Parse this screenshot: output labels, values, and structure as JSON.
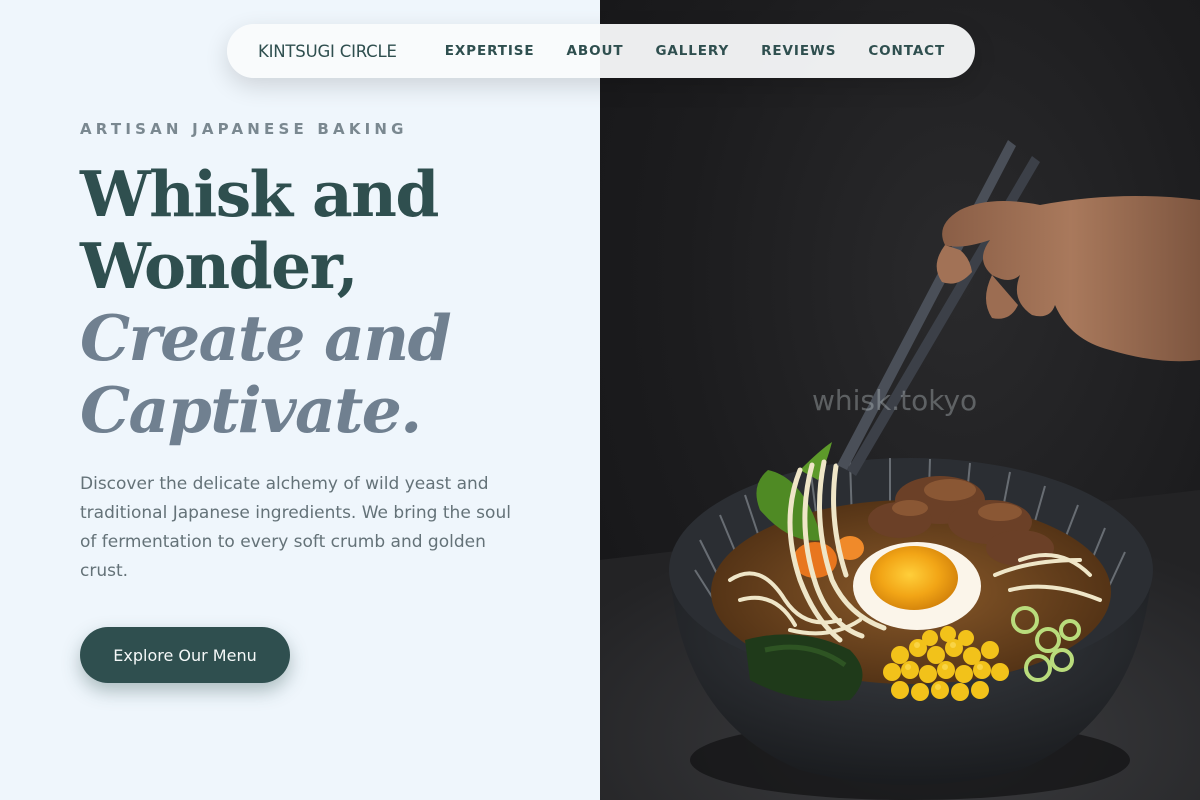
{
  "nav": {
    "brand": "KINTSUGI CIRCLE",
    "links": [
      "EXPERTISE",
      "ABOUT",
      "GALLERY",
      "REVIEWS",
      "CONTACT"
    ]
  },
  "hero": {
    "eyebrow": "ARTISAN JAPANESE BAKING",
    "headline": {
      "line1": "Whisk and",
      "line2": "Wonder,",
      "line3": "Create and",
      "line4": "Captivate."
    },
    "description": "Discover the delicate alchemy of wild yeast and traditional Japanese ingredients. We bring the soul of fermentation to every soft crumb and golden crust.",
    "cta_label": "Explore Our Menu"
  },
  "image": {
    "watermark": "whisk.tokyo"
  },
  "colors": {
    "primary": "#2f4f4f",
    "accent_italic": "#708090",
    "background": "#eff6fc",
    "image_background": "#1c1c1e"
  }
}
